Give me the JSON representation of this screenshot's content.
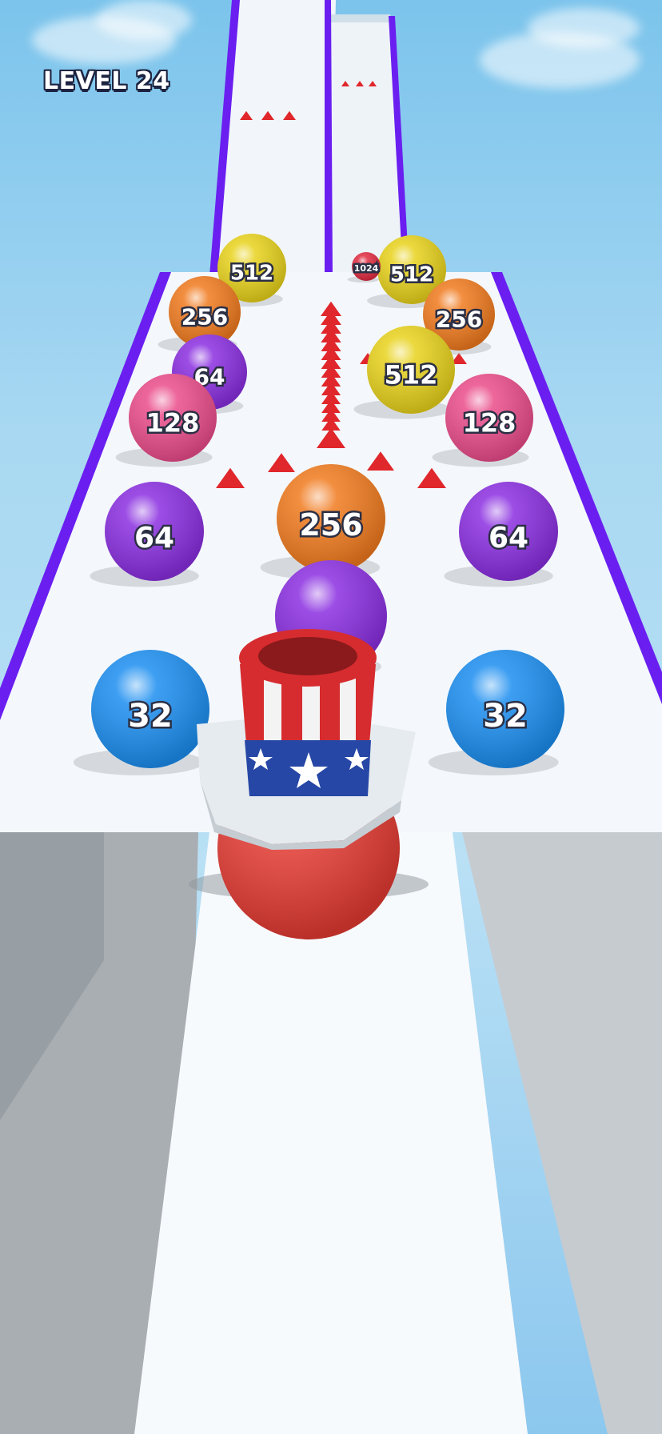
{
  "hud": {
    "level_text": "LEVEL 24"
  },
  "colors": {
    "track": "#f4f8fc",
    "rail": "#6a1ff0",
    "spike": "#e0272c",
    "ball_512": "#e8d21c",
    "ball_256": "#f07a1e",
    "ball_128": "#ea4c8a",
    "ball_64": "#8a2ee0",
    "ball_32": "#1c8ef0",
    "ball_1024": "#e02a40",
    "ball_player": "#e33a32"
  },
  "balls": [
    {
      "value": "512",
      "color": "ball_512"
    },
    {
      "value": "512",
      "color": "ball_512"
    },
    {
      "value": "1024",
      "color": "ball_1024"
    },
    {
      "value": "256",
      "color": "ball_256"
    },
    {
      "value": "256",
      "color": "ball_256"
    },
    {
      "value": "64",
      "color": "ball_64"
    },
    {
      "value": "512",
      "color": "ball_512"
    },
    {
      "value": "128",
      "color": "ball_128"
    },
    {
      "value": "128",
      "color": "ball_128"
    },
    {
      "value": "256",
      "color": "ball_256"
    },
    {
      "value": "64",
      "color": "ball_64"
    },
    {
      "value": "64",
      "color": "ball_64"
    },
    {
      "value": "",
      "color": "ball_64"
    },
    {
      "value": "32",
      "color": "ball_32"
    },
    {
      "value": "32",
      "color": "ball_32"
    }
  ],
  "player": {
    "hat": "uncle-sam-top-hat",
    "ball_color": "ball_player"
  }
}
